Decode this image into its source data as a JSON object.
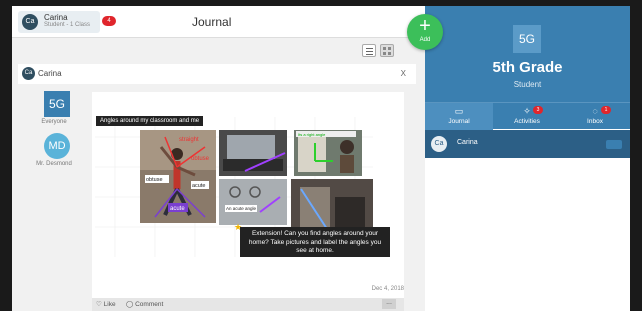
{
  "header": {
    "title": "Journal",
    "user": {
      "initials": "Ca",
      "name": "Carina",
      "subtitle": "Student - 1 Class",
      "badge": "4"
    }
  },
  "fab": {
    "label": "Add",
    "icon": "+"
  },
  "post": {
    "author_initials": "Ca",
    "author": "Carina",
    "close": "X",
    "class_badge": "5G",
    "class_sub": "Everyone",
    "teacher_initials": "MD",
    "teacher": "Mr. Desmond",
    "caption": "Angles around my classroom and me",
    "photo_labels": {
      "straight": "straight",
      "obtuse1": "obtuse",
      "obtuse2": "obtuse",
      "acute1": "acute",
      "acute2": "acute",
      "right": "Its a right angle",
      "acute_label": "An acute angle"
    },
    "extension": "Extension! Can you find angles around your home? Take pictures and label the angles you see at home.",
    "date": "Dec 4, 2018",
    "like": "Like",
    "comment": "Comment",
    "more": "..."
  },
  "right_panel": {
    "class_badge": "5G",
    "class_name": "5th Grade",
    "role": "Student",
    "tabs": [
      {
        "label": "Journal",
        "badge": ""
      },
      {
        "label": "Activities",
        "badge": "3"
      },
      {
        "label": "Inbox",
        "badge": "1"
      }
    ],
    "student_initials": "Ca",
    "student_name": "Carina"
  },
  "colors": {
    "brand_blue": "#3a7fb0",
    "add_green": "#3cbf5a",
    "badge_red": "#e0262c"
  }
}
